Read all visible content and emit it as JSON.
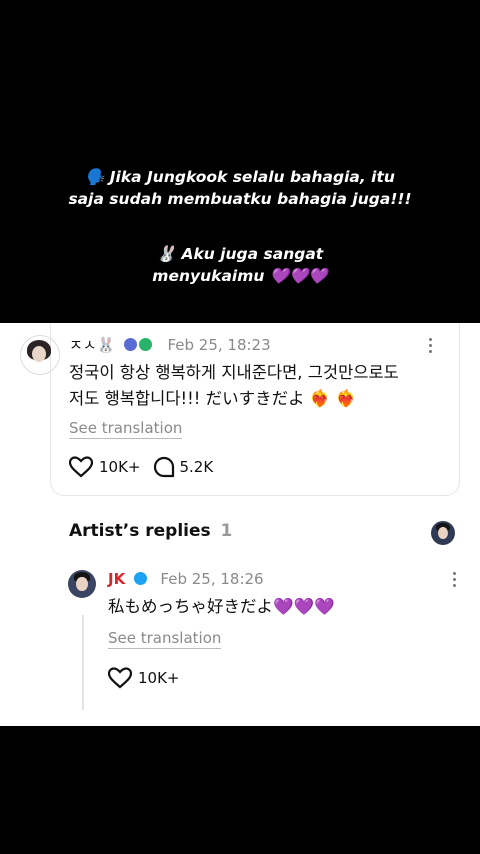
{
  "overlay": {
    "line1a": "🗣️ Jika Jungkook selalu bahagia, itu",
    "line1b": "saja sudah membuatku bahagia juga!!!",
    "line2a": "🐰 Aku juga sangat",
    "line2b": "menyukaimu 💜💜💜"
  },
  "post": {
    "username": "ㅈㅅ🐰",
    "timestamp": "Feb 25, 18:23",
    "text_line1": "정국이 항상 행복하게 지내준다면, 그것만으로도",
    "text_line2": "저도 행복합니다!!! だいすきだよ ❤️‍🔥 ❤️‍🔥",
    "see_translation": "See translation",
    "likes": "10K+",
    "comments": "5.2K"
  },
  "artist_replies": {
    "title": "Artist’s replies",
    "count": "1"
  },
  "reply": {
    "username": "JK",
    "timestamp": "Feb 25, 18:26",
    "text": "私もめっちゃ好きだよ💜💜💜",
    "see_translation": "See translation",
    "likes": "10K+"
  },
  "colors": {
    "accent_red": "#d9262b",
    "verified_blue": "#1da1f2",
    "muted_gray": "#8a8a8a"
  }
}
